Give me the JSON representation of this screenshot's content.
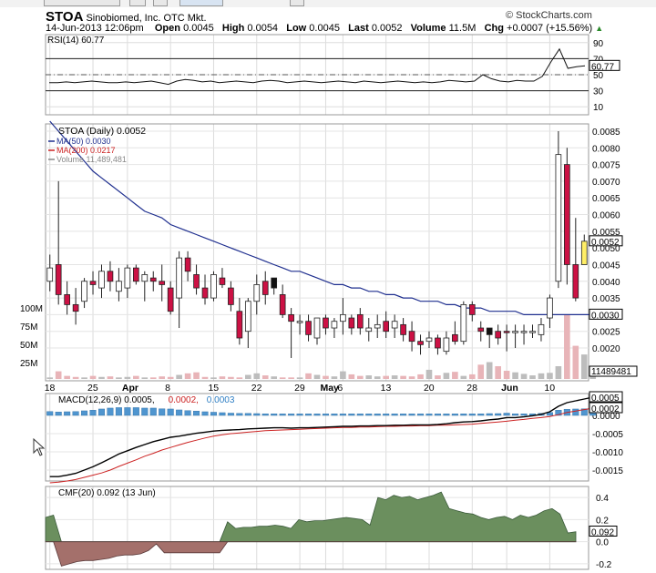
{
  "header": {
    "symbol": "STOA",
    "company": "Sinobiomed, Inc.",
    "exchange": "OTC Mkt.",
    "copyright": "© StockCharts.com",
    "datetime": "14-Jun-2013 12:06pm",
    "open_label": "Open",
    "open": "0.0045",
    "high_label": "High",
    "high": "0.0054",
    "low_label": "Low",
    "low": "0.0045",
    "last_label": "Last",
    "last": "0.0052",
    "volume_label": "Volume",
    "volume": "11.5M",
    "chg_label": "Chg",
    "chg": "+0.0007 (+15.56%)",
    "chg_arrow": "▲"
  },
  "chart_data": [
    {
      "type": "line",
      "panel": "RSI",
      "title": "RSI(14) 60.77",
      "yticks": [
        90,
        70,
        50,
        30,
        10
      ],
      "ylim": [
        0,
        100
      ],
      "reference_lines": [
        70,
        30
      ],
      "last_value_label": "60.77",
      "values": [
        40,
        40,
        41,
        40,
        41,
        42,
        41,
        40,
        40,
        41,
        40,
        41,
        42,
        40,
        38,
        42,
        44,
        43,
        41,
        42,
        40,
        41,
        42,
        41,
        40,
        42,
        43,
        42,
        40,
        41,
        42,
        41,
        40,
        41,
        42,
        41,
        40,
        42,
        41,
        40,
        41,
        42,
        41,
        40,
        41,
        40,
        41,
        43,
        42,
        41,
        42,
        50,
        45,
        42,
        41,
        43,
        42,
        42,
        48,
        66,
        82,
        58,
        60,
        61
      ]
    },
    {
      "type": "candlestick",
      "panel": "Price",
      "title": "STOA (Daily) 0.0052",
      "legend": [
        {
          "label": "MA(50) 0.0030",
          "color": "#1f2f8f"
        },
        {
          "label": "MA(200) 0.0217",
          "color": "#cc2222"
        },
        {
          "label": "Volume 11,489,481",
          "color": "#888888"
        }
      ],
      "yticks": [
        "0.0085",
        "0.0080",
        "0.0075",
        "0.0070",
        "0.0065",
        "0.0060",
        "0.0055",
        "0.0050",
        "0.0045",
        "0.0040",
        "0.0035",
        "0.0030",
        "0.0025",
        "0.0020"
      ],
      "price_flags": [
        "0.0052",
        "0.0030"
      ],
      "volume_ticks": [
        "100M",
        "75M",
        "50M",
        "25M"
      ],
      "volume_flag": "11489481",
      "x_tick_labels": [
        {
          "label": "18",
          "i": 0
        },
        {
          "label": "25",
          "i": 5
        },
        {
          "label": "Apr",
          "i": 9
        },
        {
          "label": "8",
          "i": 14
        },
        {
          "label": "15",
          "i": 19
        },
        {
          "label": "22",
          "i": 24
        },
        {
          "label": "29",
          "i": 29
        },
        {
          "label": "May",
          "i": 32
        },
        {
          "label": "6",
          "i": 34
        },
        {
          "label": "13",
          "i": 39
        },
        {
          "label": "20",
          "i": 44
        },
        {
          "label": "28",
          "i": 49
        },
        {
          "label": "Jun",
          "i": 53
        },
        {
          "label": "10",
          "i": 58
        }
      ],
      "candles": [
        {
          "o": 0.0044,
          "h": 0.0048,
          "l": 0.0037,
          "c": 0.004,
          "col": "w"
        },
        {
          "o": 0.0045,
          "h": 0.007,
          "l": 0.0033,
          "c": 0.0036,
          "col": "r"
        },
        {
          "o": 0.0036,
          "h": 0.004,
          "l": 0.003,
          "c": 0.0033,
          "col": "r"
        },
        {
          "o": 0.0031,
          "h": 0.0038,
          "l": 0.0027,
          "c": 0.0033,
          "col": "r"
        },
        {
          "o": 0.0034,
          "h": 0.0041,
          "l": 0.0032,
          "c": 0.004,
          "col": "w"
        },
        {
          "o": 0.004,
          "h": 0.0043,
          "l": 0.0036,
          "c": 0.0039,
          "col": "r"
        },
        {
          "o": 0.0038,
          "h": 0.0045,
          "l": 0.0035,
          "c": 0.0043,
          "col": "w"
        },
        {
          "o": 0.0043,
          "h": 0.0046,
          "l": 0.0037,
          "c": 0.004,
          "col": "r"
        },
        {
          "o": 0.004,
          "h": 0.0044,
          "l": 0.0034,
          "c": 0.0037,
          "col": "w"
        },
        {
          "o": 0.0038,
          "h": 0.0045,
          "l": 0.0035,
          "c": 0.0044,
          "col": "w"
        },
        {
          "o": 0.0044,
          "h": 0.0045,
          "l": 0.0039,
          "c": 0.004,
          "col": "r"
        },
        {
          "o": 0.004,
          "h": 0.0043,
          "l": 0.0034,
          "c": 0.0042,
          "col": "w"
        },
        {
          "o": 0.0041,
          "h": 0.0043,
          "l": 0.0037,
          "c": 0.004,
          "col": "r"
        },
        {
          "o": 0.0039,
          "h": 0.0045,
          "l": 0.0034,
          "c": 0.004,
          "col": "r"
        },
        {
          "o": 0.0038,
          "h": 0.004,
          "l": 0.003,
          "c": 0.0031,
          "col": "r"
        },
        {
          "o": 0.0035,
          "h": 0.0049,
          "l": 0.0026,
          "c": 0.0047,
          "col": "w"
        },
        {
          "o": 0.0047,
          "h": 0.0049,
          "l": 0.004,
          "c": 0.0043,
          "col": "r"
        },
        {
          "o": 0.0042,
          "h": 0.0045,
          "l": 0.0036,
          "c": 0.0038,
          "col": "r"
        },
        {
          "o": 0.0038,
          "h": 0.0042,
          "l": 0.0033,
          "c": 0.0035,
          "col": "r"
        },
        {
          "o": 0.0035,
          "h": 0.0043,
          "l": 0.0034,
          "c": 0.0042,
          "col": "w"
        },
        {
          "o": 0.0041,
          "h": 0.0044,
          "l": 0.0038,
          "c": 0.0039,
          "col": "r"
        },
        {
          "o": 0.0038,
          "h": 0.004,
          "l": 0.0031,
          "c": 0.0033,
          "col": "r"
        },
        {
          "o": 0.0031,
          "h": 0.0035,
          "l": 0.0021,
          "c": 0.0023,
          "col": "r"
        },
        {
          "o": 0.0025,
          "h": 0.0035,
          "l": 0.002,
          "c": 0.0034,
          "col": "w"
        },
        {
          "o": 0.0034,
          "h": 0.0042,
          "l": 0.003,
          "c": 0.0039,
          "col": "w"
        },
        {
          "o": 0.004,
          "h": 0.0043,
          "l": 0.0033,
          "c": 0.0036,
          "col": "r"
        },
        {
          "o": 0.0038,
          "h": 0.0041,
          "l": 0.0036,
          "c": 0.0041,
          "col": "b"
        },
        {
          "o": 0.0036,
          "h": 0.0039,
          "l": 0.0029,
          "c": 0.003,
          "col": "r"
        },
        {
          "o": 0.003,
          "h": 0.0032,
          "l": 0.0017,
          "c": 0.0028,
          "col": "r"
        },
        {
          "o": 0.0028,
          "h": 0.003,
          "l": 0.0024,
          "c": 0.0028,
          "col": "w"
        },
        {
          "o": 0.0028,
          "h": 0.003,
          "l": 0.0022,
          "c": 0.0024,
          "col": "r"
        },
        {
          "o": 0.0023,
          "h": 0.0029,
          "l": 0.0021,
          "c": 0.0029,
          "col": "w"
        },
        {
          "o": 0.0029,
          "h": 0.003,
          "l": 0.0024,
          "c": 0.0026,
          "col": "r"
        },
        {
          "o": 0.0026,
          "h": 0.0029,
          "l": 0.0023,
          "c": 0.0028,
          "col": "w"
        },
        {
          "o": 0.0028,
          "h": 0.0035,
          "l": 0.0024,
          "c": 0.003,
          "col": "w"
        },
        {
          "o": 0.0029,
          "h": 0.003,
          "l": 0.0024,
          "c": 0.0026,
          "col": "r"
        },
        {
          "o": 0.003,
          "h": 0.0032,
          "l": 0.0024,
          "c": 0.0026,
          "col": "r"
        },
        {
          "o": 0.0026,
          "h": 0.0029,
          "l": 0.0022,
          "c": 0.0025,
          "col": "w"
        },
        {
          "o": 0.0026,
          "h": 0.003,
          "l": 0.0023,
          "c": 0.0027,
          "col": "w"
        },
        {
          "o": 0.0028,
          "h": 0.0031,
          "l": 0.0023,
          "c": 0.0025,
          "col": "r"
        },
        {
          "o": 0.0026,
          "h": 0.003,
          "l": 0.0023,
          "c": 0.0028,
          "col": "w"
        },
        {
          "o": 0.0027,
          "h": 0.0029,
          "l": 0.0022,
          "c": 0.0024,
          "col": "r"
        },
        {
          "o": 0.0025,
          "h": 0.0028,
          "l": 0.0019,
          "c": 0.0022,
          "col": "r"
        },
        {
          "o": 0.0022,
          "h": 0.0024,
          "l": 0.0018,
          "c": 0.0021,
          "col": "r"
        },
        {
          "o": 0.0022,
          "h": 0.0025,
          "l": 0.002,
          "c": 0.0023,
          "col": "w"
        },
        {
          "o": 0.0023,
          "h": 0.0024,
          "l": 0.0018,
          "c": 0.002,
          "col": "r"
        },
        {
          "o": 0.0019,
          "h": 0.0025,
          "l": 0.0018,
          "c": 0.0023,
          "col": "w"
        },
        {
          "o": 0.0024,
          "h": 0.0028,
          "l": 0.0021,
          "c": 0.0022,
          "col": "r"
        },
        {
          "o": 0.0022,
          "h": 0.0034,
          "l": 0.0021,
          "c": 0.0033,
          "col": "w"
        },
        {
          "o": 0.0033,
          "h": 0.0034,
          "l": 0.0028,
          "c": 0.003,
          "col": "r"
        },
        {
          "o": 0.0026,
          "h": 0.0028,
          "l": 0.0022,
          "c": 0.0025,
          "col": "r"
        },
        {
          "o": 0.0024,
          "h": 0.0026,
          "l": 0.002,
          "c": 0.0026,
          "col": "b"
        },
        {
          "o": 0.0025,
          "h": 0.0027,
          "l": 0.0021,
          "c": 0.0023,
          "col": "r"
        },
        {
          "o": 0.0025,
          "h": 0.0027,
          "l": 0.0019,
          "c": 0.0025,
          "col": "r"
        },
        {
          "o": 0.0025,
          "h": 0.0027,
          "l": 0.002,
          "c": 0.0025,
          "col": "w"
        },
        {
          "o": 0.0025,
          "h": 0.0027,
          "l": 0.0021,
          "c": 0.0025,
          "col": "w"
        },
        {
          "o": 0.0025,
          "h": 0.0027,
          "l": 0.0023,
          "c": 0.0025,
          "col": "w"
        },
        {
          "o": 0.0024,
          "h": 0.0029,
          "l": 0.0022,
          "c": 0.0027,
          "col": "w"
        },
        {
          "o": 0.0029,
          "h": 0.0036,
          "l": 0.0026,
          "c": 0.0035,
          "col": "w"
        },
        {
          "o": 0.004,
          "h": 0.0085,
          "l": 0.0038,
          "c": 0.0078,
          "col": "w"
        },
        {
          "o": 0.0075,
          "h": 0.008,
          "l": 0.0039,
          "c": 0.0045,
          "col": "r"
        },
        {
          "o": 0.0045,
          "h": 0.0059,
          "l": 0.0034,
          "c": 0.0035,
          "col": "r"
        },
        {
          "o": 0.0045,
          "h": 0.0054,
          "l": 0.0045,
          "c": 0.0052,
          "col": "y"
        }
      ],
      "ma50": [
        0.0088,
        0.0085,
        0.0082,
        0.0079,
        0.0076,
        0.0073,
        0.0071,
        0.0069,
        0.0067,
        0.0065,
        0.0063,
        0.0061,
        0.006,
        0.0059,
        0.0057,
        0.0056,
        0.0055,
        0.0054,
        0.0053,
        0.0052,
        0.0051,
        0.005,
        0.0049,
        0.0048,
        0.0047,
        0.0046,
        0.0045,
        0.0044,
        0.0043,
        0.0043,
        0.0042,
        0.0041,
        0.004,
        0.0039,
        0.0039,
        0.0038,
        0.0038,
        0.0037,
        0.0037,
        0.0036,
        0.0036,
        0.0035,
        0.0035,
        0.0034,
        0.0034,
        0.0034,
        0.0033,
        0.0033,
        0.0032,
        0.0032,
        0.0032,
        0.0031,
        0.0031,
        0.0031,
        0.0031,
        0.003,
        0.003,
        0.003,
        0.003,
        0.003,
        0.003,
        0.003,
        0.003,
        0.003
      ],
      "volume_m": [
        3,
        15,
        6,
        4,
        3,
        6,
        4,
        5,
        3,
        4,
        6,
        3,
        3,
        5,
        4,
        8,
        11,
        13,
        4,
        3,
        5,
        4,
        3,
        8,
        11,
        7,
        5,
        3,
        3,
        3,
        11,
        8,
        6,
        5,
        15,
        9,
        6,
        7,
        5,
        6,
        7,
        6,
        5,
        9,
        18,
        7,
        12,
        14,
        6,
        9,
        28,
        33,
        25,
        16,
        13,
        10,
        7,
        11,
        12,
        25,
        125,
        65,
        48,
        11
      ]
    },
    {
      "type": "line",
      "panel": "MACD",
      "title": "MACD(12,26,9) 0.0005, 0.0002, 0.0003",
      "legend": [
        {
          "label": "MACD(12,26,9) 0.0005,",
          "color": "#000000"
        },
        {
          "label": "0.0002,",
          "color": "#cc2222"
        },
        {
          "label": "0.0003",
          "color": "#2f7fc4"
        }
      ],
      "yticks": [
        "-0.0015",
        "-0.0010",
        "-0.0005",
        "0.0000"
      ],
      "ylim": [
        -0.0018,
        0.0006
      ],
      "value_flags": [
        "0.0005",
        "0.0002"
      ],
      "macd": [
        -0.00168,
        -0.00168,
        -0.00164,
        -0.00159,
        -0.0015,
        -0.00141,
        -0.0013,
        -0.00118,
        -0.00106,
        -0.00097,
        -0.00088,
        -0.0008,
        -0.00072,
        -0.00066,
        -0.0006,
        -0.00057,
        -0.00053,
        -0.00049,
        -0.00046,
        -0.00043,
        -0.00041,
        -0.0004,
        -0.00039,
        -0.00037,
        -0.00036,
        -0.00035,
        -0.00034,
        -0.00034,
        -0.00035,
        -0.00034,
        -0.00034,
        -0.00033,
        -0.00032,
        -0.00031,
        -0.0003,
        -0.0003,
        -0.00029,
        -0.00029,
        -0.00028,
        -0.00028,
        -0.00027,
        -0.00027,
        -0.00026,
        -0.00026,
        -0.00026,
        -0.00025,
        -0.00023,
        -0.0002,
        -0.00018,
        -0.00017,
        -0.00015,
        -0.00012,
        -0.0001,
        -6e-05,
        -6e-05,
        -4e-05,
        -1e-05,
        3e-05,
        0.0001,
        0.00025,
        0.00035,
        0.0004,
        0.00045,
        0.0005
      ],
      "signal": [
        -0.00185,
        -0.00183,
        -0.0018,
        -0.00176,
        -0.0017,
        -0.00164,
        -0.00158,
        -0.0015,
        -0.0014,
        -0.00131,
        -0.00122,
        -0.00112,
        -0.00104,
        -0.00095,
        -0.00088,
        -0.00081,
        -0.00074,
        -0.00068,
        -0.00062,
        -0.00057,
        -0.00053,
        -0.0005,
        -0.00048,
        -0.00046,
        -0.00044,
        -0.00042,
        -0.00041,
        -0.0004,
        -0.00039,
        -0.00038,
        -0.00037,
        -0.00036,
        -0.00035,
        -0.00034,
        -0.00033,
        -0.00033,
        -0.00032,
        -0.00032,
        -0.00031,
        -0.0003,
        -0.0003,
        -0.00029,
        -0.00029,
        -0.00028,
        -0.00028,
        -0.00027,
        -0.00027,
        -0.00026,
        -0.00025,
        -0.00024,
        -0.00022,
        -0.0002,
        -0.00018,
        -0.00016,
        -0.00013,
        -0.00011,
        -8e-05,
        -6e-05,
        -3e-05,
        2e-05,
        8e-05,
        0.00012,
        0.00016,
        0.0002
      ]
    },
    {
      "type": "area",
      "panel": "CMF",
      "title": "CMF(20) 0.092 (13 Jun)",
      "yticks": [
        "0.4",
        "0.2",
        "0.0",
        "-0.2"
      ],
      "ylim": [
        -0.25,
        0.5
      ],
      "value_flag": "0.092",
      "positive_color": "#6b8f5e",
      "negative_color": "#a4706b",
      "values": [
        0.22,
        0.24,
        -0.22,
        -0.2,
        -0.18,
        -0.17,
        -0.17,
        -0.16,
        -0.15,
        -0.13,
        -0.12,
        -0.12,
        -0.11,
        -0.08,
        -0.02,
        -0.1,
        -0.1,
        -0.1,
        -0.1,
        -0.1,
        -0.1,
        -0.1,
        -0.1,
        0.18,
        0.12,
        0.13,
        0.13,
        0.14,
        0.14,
        0.15,
        0.14,
        0.12,
        0.2,
        0.18,
        0.19,
        0.19,
        0.2,
        0.21,
        0.22,
        0.21,
        0.2,
        0.15,
        0.4,
        0.38,
        0.42,
        0.4,
        0.41,
        0.38,
        0.4,
        0.42,
        0.45,
        0.3,
        0.28,
        0.26,
        0.25,
        0.22,
        0.2,
        0.22,
        0.23,
        0.2,
        0.24,
        0.22,
        0.24,
        0.28,
        0.3,
        0.25,
        0.08,
        0.09
      ]
    }
  ]
}
